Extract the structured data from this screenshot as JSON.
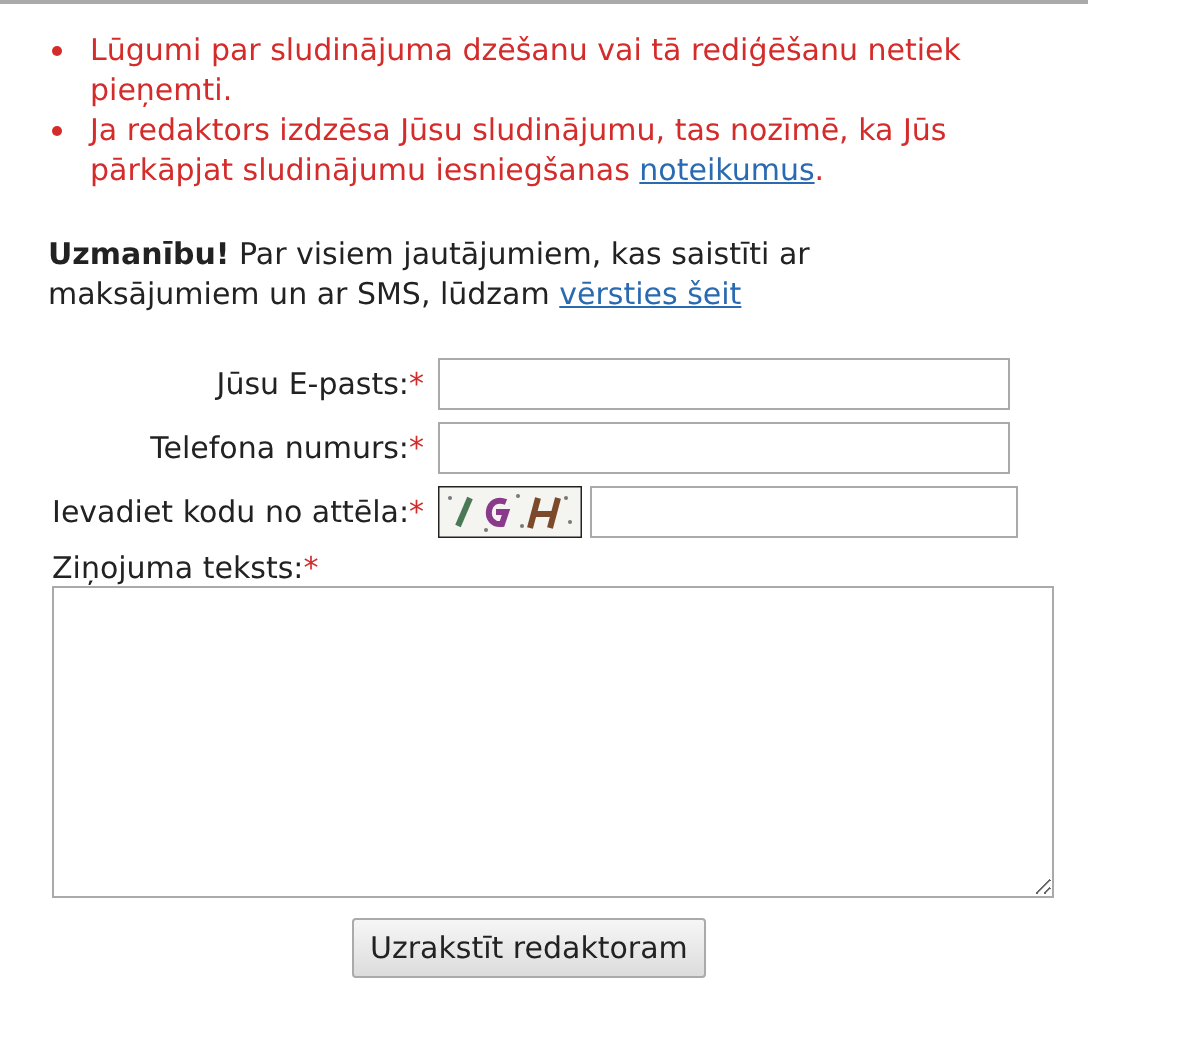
{
  "rules": [
    {
      "text": "Lūgumi par sludinājuma dzēšanu vai tā rediģēšanu netiek pieņemti."
    },
    {
      "text": "Ja redaktors izdzēsa Jūsu sludinājumu, tas nozīmē, ka Jūs pārkāpjat sludinājumu iesniegšanas ",
      "link": "noteikumus",
      "after": "."
    }
  ],
  "notice": {
    "text": "**Uzmanību!** Par visiem jautājumiem, kas saistīti ar maksājumiem un ar SMS, lūdzam ",
    "link": "vērsties šeit"
  },
  "fields": [
    {
      "kind": "text",
      "label": "Jūsu E-pasts:",
      "mark": "*"
    },
    {
      "kind": "text",
      "label": "Telefona numurs:",
      "mark": "*"
    },
    {
      "kind": "captcha",
      "label": "Ievadiet kodu no attēla:",
      "mark": "*"
    }
  ],
  "message": {
    "label": "Ziņojuma teksts:",
    "mark": "*"
  },
  "submit": "Uzrakstīt redaktoram"
}
